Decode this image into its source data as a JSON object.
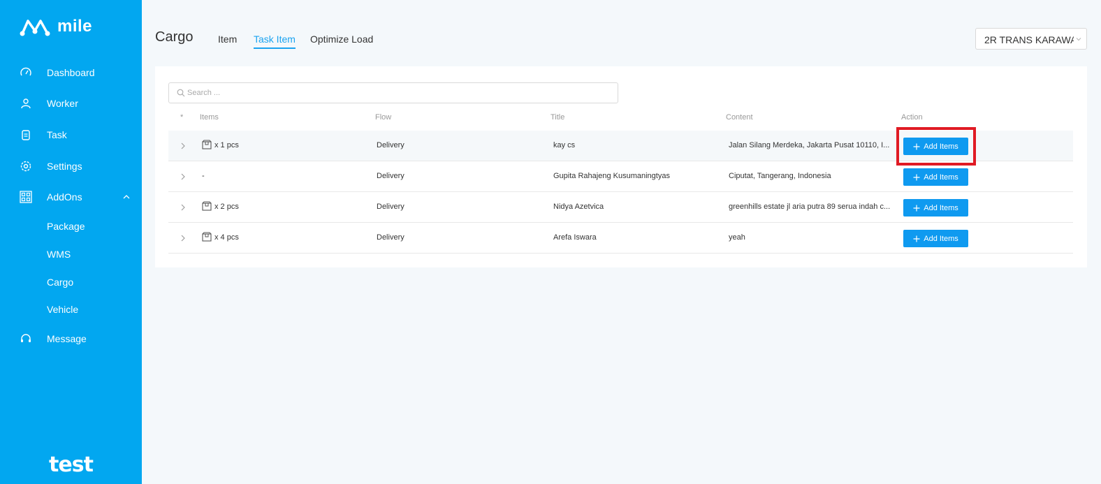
{
  "brand": {
    "name": "mile",
    "footer": "test"
  },
  "colors": {
    "sidebar": "#02a7f0",
    "accent": "#1ba3f0",
    "button": "#0f9af0",
    "highlight": "#e01b24"
  },
  "sidebar": {
    "items": [
      {
        "label": "Dashboard",
        "icon": "gauge-icon"
      },
      {
        "label": "Worker",
        "icon": "user-icon"
      },
      {
        "label": "Task",
        "icon": "clipboard-icon"
      },
      {
        "label": "Settings",
        "icon": "gear-icon"
      },
      {
        "label": "AddOns",
        "icon": "grid-icon"
      }
    ],
    "addons_sub": [
      "Package",
      "WMS",
      "Cargo",
      "Vehicle"
    ],
    "message": {
      "label": "Message",
      "icon": "headset-icon"
    }
  },
  "header": {
    "title": "Cargo",
    "tabs": [
      "Item",
      "Task Item",
      "Optimize Load"
    ],
    "active_tab": "Task Item",
    "company_select": "2R TRANS KARAWA"
  },
  "search": {
    "placeholder": "Search ..."
  },
  "table": {
    "columns": [
      "*",
      "Items",
      "Flow",
      "Title",
      "Content",
      "Action"
    ],
    "rows": [
      {
        "items": "x 1 pcs",
        "flow": "Delivery",
        "title": "kay cs",
        "content": "Jalan Silang Merdeka, Jakarta Pusat 10110, I...",
        "action": "Add Items"
      },
      {
        "items": "-",
        "flow": "Delivery",
        "title": "Gupita Rahajeng Kusumaningtyas",
        "content": "Ciputat, Tangerang, Indonesia",
        "action": "Add Items"
      },
      {
        "items": "x 2 pcs",
        "flow": "Delivery",
        "title": "Nidya Azetvica",
        "content": "greenhills estate jl aria putra 89 serua indah c...",
        "action": "Add Items"
      },
      {
        "items": "x 4 pcs",
        "flow": "Delivery",
        "title": "Arefa Iswara",
        "content": "yeah",
        "action": "Add Items"
      }
    ]
  }
}
